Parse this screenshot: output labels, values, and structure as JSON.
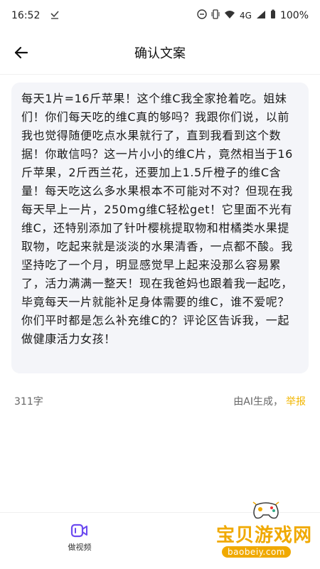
{
  "status_bar": {
    "time": "16:52",
    "network": "4G",
    "battery": "100%"
  },
  "header": {
    "title": "确认文案"
  },
  "copy": {
    "text": "每天1片=16斤苹果！这个维C我全家抢着吃。姐妹们！你们每天吃的维C真的够吗？我跟你们说，以前我也觉得随便吃点水果就行了，直到我看到这个数据！你敢信吗？这一片小小的维C片，竟然相当于16斤苹果，2斤西兰花，还要加上1.5斤橙子的维C含量！每天吃这么多水果根本不可能对不对？但现在我每天早上一片，250mg维C轻松get！它里面不光有维C，还特别添加了针叶樱桃提取物和柑橘类水果提取物，吃起来就是淡淡的水果清香，一点都不酸。我坚持吃了一个月，明显感觉早上起来没那么容易累了，活力满满一整天！现在我爸妈也跟着我一起吃，毕竟每天一片就能补足身体需要的维C，谁不爱呢？你们平时都是怎么补充维C的？评论区告诉我，一起做健康活力女孩！"
  },
  "meta": {
    "char_count": "311字",
    "ai_generated": "由AI生成，",
    "report": "举报"
  },
  "bottom": {
    "make_video_label": "做视频"
  },
  "watermark": {
    "title": "宝贝游戏网",
    "url": "baobeiy.com"
  },
  "colors": {
    "accent_purple": "#6c4bf0",
    "report_yellow": "#f2b600",
    "card_bg": "#f4f5f9"
  }
}
